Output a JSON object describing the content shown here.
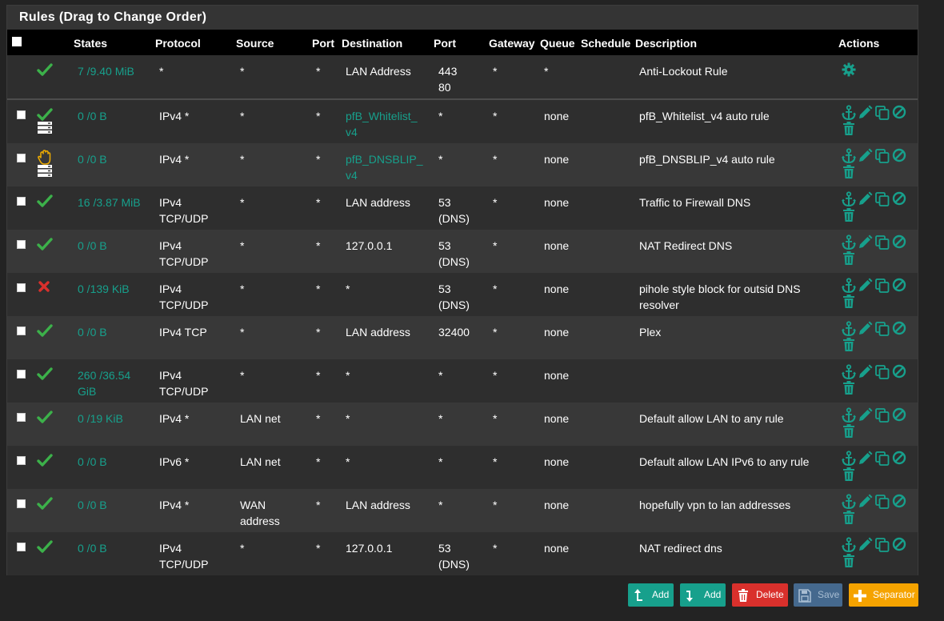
{
  "panel": {
    "title": "Rules (Drag to Change Order)"
  },
  "table": {
    "headers": {
      "states": "States",
      "protocol": "Protocol",
      "source": "Source",
      "source_port": "Port",
      "destination": "Destination",
      "dest_port": "Port",
      "gateway": "Gateway",
      "queue": "Queue",
      "schedule": "Schedule",
      "description": "Description",
      "actions": "Actions"
    },
    "rows": [
      {
        "status": "pass",
        "log": false,
        "states": "7 /9.40 MiB",
        "protocol": "*",
        "source": "*",
        "sport": "*",
        "dest": "LAN Address",
        "dport": "443\n80",
        "gateway": "*",
        "queue": "*",
        "schedule": "",
        "description": "Anti-Lockout Rule",
        "anti_lockout": true
      },
      {
        "status": "pass",
        "log": true,
        "states": "0 /0 B",
        "protocol": "IPv4 *",
        "source": "*",
        "sport": "*",
        "dest": "pfB_Whitelist_\nv4",
        "dest_link": true,
        "dport": "*",
        "gateway": "*",
        "queue": "none",
        "schedule": "",
        "description": "pfB_Whitelist_v4 auto rule"
      },
      {
        "status": "block",
        "log": true,
        "states": "0 /0 B",
        "protocol": "IPv4 *",
        "source": "*",
        "sport": "*",
        "dest": "pfB_DNSBLIP_\nv4",
        "dest_link": true,
        "dport": "*",
        "gateway": "*",
        "queue": "none",
        "schedule": "",
        "description": "pfB_DNSBLIP_v4 auto rule"
      },
      {
        "status": "pass",
        "log": false,
        "states": "16 /3.87 MiB",
        "protocol": "IPv4\nTCP/UDP",
        "source": "*",
        "sport": "*",
        "dest": "LAN address",
        "dport": "53\n(DNS)",
        "gateway": "*",
        "queue": "none",
        "schedule": "",
        "description": "Traffic to Firewall DNS"
      },
      {
        "status": "pass",
        "log": false,
        "states": "0 /0 B",
        "protocol": "IPv4\nTCP/UDP",
        "source": "*",
        "sport": "*",
        "dest": "127.0.0.1",
        "dport": "53\n(DNS)",
        "gateway": "*",
        "queue": "none",
        "schedule": "",
        "description": "NAT Redirect DNS"
      },
      {
        "status": "reject",
        "log": false,
        "states": "0 /139 KiB",
        "protocol": "IPv4\nTCP/UDP",
        "source": "*",
        "sport": "*",
        "dest": "*",
        "dport": "53\n(DNS)",
        "gateway": "*",
        "queue": "none",
        "schedule": "",
        "description": "pihole style block for outsid DNS\nresolver"
      },
      {
        "status": "pass",
        "log": false,
        "states": "0 /0 B",
        "protocol": "IPv4 TCP",
        "source": "*",
        "sport": "*",
        "dest": "LAN address",
        "dport": "32400",
        "gateway": "*",
        "queue": "none",
        "schedule": "",
        "description": "Plex"
      },
      {
        "status": "pass",
        "log": false,
        "states": "260 /36.54\nGiB",
        "protocol": "IPv4\nTCP/UDP",
        "source": "*",
        "sport": "*",
        "dest": "*",
        "dport": "*",
        "gateway": "*",
        "queue": "none",
        "schedule": "",
        "description": ""
      },
      {
        "status": "pass",
        "log": false,
        "states": "0 /19 KiB",
        "protocol": "IPv4 *",
        "source": "LAN net",
        "sport": "*",
        "dest": "*",
        "dport": "*",
        "gateway": "*",
        "queue": "none",
        "schedule": "",
        "description": "Default allow LAN to any rule"
      },
      {
        "status": "pass",
        "log": false,
        "states": "0 /0 B",
        "protocol": "IPv6 *",
        "source": "LAN net",
        "sport": "*",
        "dest": "*",
        "dport": "*",
        "gateway": "*",
        "queue": "none",
        "schedule": "",
        "description": "Default allow LAN IPv6 to any rule"
      },
      {
        "status": "pass",
        "log": false,
        "states": "0 /0 B",
        "protocol": "IPv4 *",
        "source": "WAN\naddress",
        "sport": "*",
        "dest": "LAN address",
        "dport": "*",
        "gateway": "*",
        "queue": "none",
        "schedule": "",
        "description": "hopefully vpn to lan addresses"
      },
      {
        "status": "pass",
        "log": false,
        "states": "0 /0 B",
        "protocol": "IPv4\nTCP/UDP",
        "source": "*",
        "sport": "*",
        "dest": "127.0.0.1",
        "dport": "53\n(DNS)",
        "gateway": "*",
        "queue": "none",
        "schedule": "",
        "description": "NAT redirect dns"
      }
    ]
  },
  "buttons": {
    "add_top": "Add",
    "add_bottom": "Add",
    "delete": "Delete",
    "save": "Save",
    "separator": "Separator"
  },
  "colors": {
    "accent": "#17a08c",
    "pass": "#3cb14a",
    "reject": "#d9302c",
    "block": "#f0ad00",
    "delete": "#d9302c",
    "save": "#45698e",
    "separator": "#f5a300"
  },
  "icons": {
    "pass": "check-icon",
    "block": "hand-icon",
    "reject": "x-icon",
    "log": "log-icon",
    "anchor": "anchor-icon",
    "edit": "pencil-icon",
    "copy": "copy-icon",
    "disable": "ban-icon",
    "delete": "trash-icon",
    "gear": "gear-icon"
  }
}
